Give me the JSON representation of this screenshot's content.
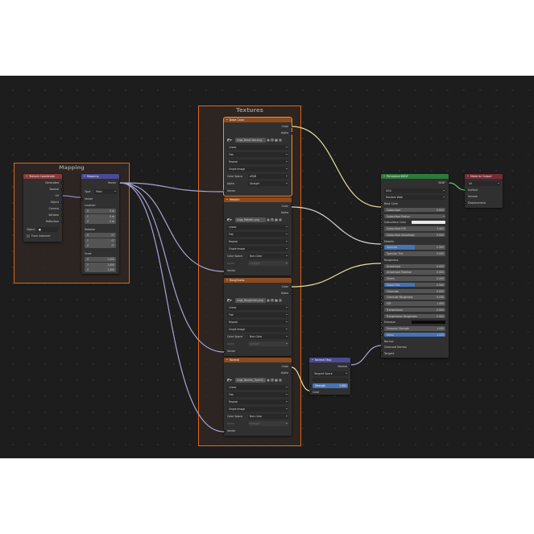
{
  "frames": {
    "mapping": "Mapping",
    "textures": "Textures"
  },
  "tex_coord": {
    "title": "Texture Coordinate",
    "outputs": [
      "Generated",
      "Normal",
      "UV",
      "Object",
      "Camera",
      "Window",
      "Reflection"
    ],
    "object_label": "Object",
    "from_instancer": "From Instancer"
  },
  "mapping": {
    "title": "Mapping",
    "output": "Vector",
    "type_label": "Type",
    "type_value": "Point",
    "input_vector": "Vector",
    "location_label": "Location",
    "location": [
      [
        "X",
        "0 m"
      ],
      [
        "Y",
        "0 m"
      ],
      [
        "Z",
        "0 m"
      ]
    ],
    "rotation_label": "Rotation",
    "rotation": [
      [
        "X",
        "0°"
      ],
      [
        "Y",
        "0°"
      ],
      [
        "Z",
        "0°"
      ]
    ],
    "scale_label": "Scale",
    "scale": [
      [
        "X",
        "1.000"
      ],
      [
        "Y",
        "1.000"
      ],
      [
        "Z",
        "1.000"
      ]
    ]
  },
  "tex_nodes": [
    {
      "title": "Base Color",
      "image": "Lego_BaseColor.png",
      "interp": "Linear",
      "proj": "Flat",
      "ext": "Repeat",
      "source": "Single Image",
      "cs_label": "Color Space",
      "cs": "sRGB",
      "alpha_label": "Alpha",
      "alpha": "Straight",
      "alpha_dim": false
    },
    {
      "title": "Metallic",
      "image": "Lego_Metallic.png",
      "interp": "Linear",
      "proj": "Flat",
      "ext": "Repeat",
      "source": "Single Image",
      "cs_label": "Color Space",
      "cs": "Non-Color",
      "alpha_label": "Alpha",
      "alpha": "Straight",
      "alpha_dim": true
    },
    {
      "title": "Roughness",
      "image": "Lego_Roughness.png",
      "interp": "Linear",
      "proj": "Flat",
      "ext": "Repeat",
      "source": "Single Image",
      "cs_label": "Color Space",
      "cs": "Non-Color",
      "alpha_label": "Alpha",
      "alpha": "Straight",
      "alpha_dim": true
    },
    {
      "title": "Normal",
      "image": "Lego_Normal_OpenG...",
      "interp": "Linear",
      "proj": "Flat",
      "ext": "Repeat",
      "source": "Single Image",
      "cs_label": "Color Space",
      "cs": "Non-Color",
      "alpha_label": "Alpha",
      "alpha": "Straight",
      "alpha_dim": true
    }
  ],
  "tex_common": {
    "out_color": "Color",
    "out_alpha": "Alpha",
    "in_vector": "Vector"
  },
  "normal_map": {
    "title": "Normal Map",
    "output": "Normal",
    "space": "Tangent Space",
    "strength_label": "Strength",
    "strength": "1.000",
    "input_color": "Color"
  },
  "bsdf": {
    "title": "Principled BSDF",
    "output": "BSDF",
    "distribution": "GGX",
    "subsurface_method": "Random Walk",
    "rows": [
      {
        "label": "Base Color",
        "kind": "socket",
        "sock": "col"
      },
      {
        "label": "Subsurface",
        "value": "0.000",
        "kind": "field"
      },
      {
        "label": "Subsurface Radius",
        "kind": "dropdown"
      },
      {
        "label": "Subsurface Color",
        "kind": "swatch"
      },
      {
        "label": "Subsurface IOR",
        "value": "1.400",
        "kind": "field"
      },
      {
        "label": "Subsurface Anisotropy",
        "value": "0.000",
        "kind": "field"
      },
      {
        "label": "Metallic",
        "kind": "socket",
        "sock": "flt"
      },
      {
        "label": "Specular",
        "value": "0.500",
        "kind": "bar",
        "fill": 0.5
      },
      {
        "label": "Specular Tint",
        "value": "0.000",
        "kind": "field"
      },
      {
        "label": "Roughness",
        "kind": "socket",
        "sock": "flt"
      },
      {
        "label": "Anisotropic",
        "value": "0.000",
        "kind": "field"
      },
      {
        "label": "Anisotropic Rotation",
        "value": "0.000",
        "kind": "field"
      },
      {
        "label": "Sheen",
        "value": "0.000",
        "kind": "field"
      },
      {
        "label": "Sheen Tint",
        "value": "0.500",
        "kind": "bar",
        "fill": 0.5
      },
      {
        "label": "Clearcoat",
        "value": "0.000",
        "kind": "field"
      },
      {
        "label": "Clearcoat Roughness",
        "value": "0.030",
        "kind": "field"
      },
      {
        "label": "IOR",
        "value": "1.450",
        "kind": "field"
      },
      {
        "label": "Transmission",
        "value": "0.000",
        "kind": "field"
      },
      {
        "label": "Transmission Roughness",
        "value": "0.000",
        "kind": "field"
      },
      {
        "label": "Emission",
        "kind": "emission"
      },
      {
        "label": "Emission Strength",
        "value": "1.000",
        "kind": "field"
      },
      {
        "label": "Alpha",
        "value": "1.000",
        "kind": "bar",
        "fill": 1.0
      },
      {
        "label": "Normal",
        "kind": "socket",
        "sock": "vec"
      },
      {
        "label": "Clearcoat Normal",
        "kind": "socket",
        "sock": "vec"
      },
      {
        "label": "Tangent",
        "kind": "socket",
        "sock": "vec"
      }
    ]
  },
  "material_output": {
    "title": "Material Output",
    "target": "All",
    "inputs": [
      "Surface",
      "Volume",
      "Displacement"
    ]
  }
}
